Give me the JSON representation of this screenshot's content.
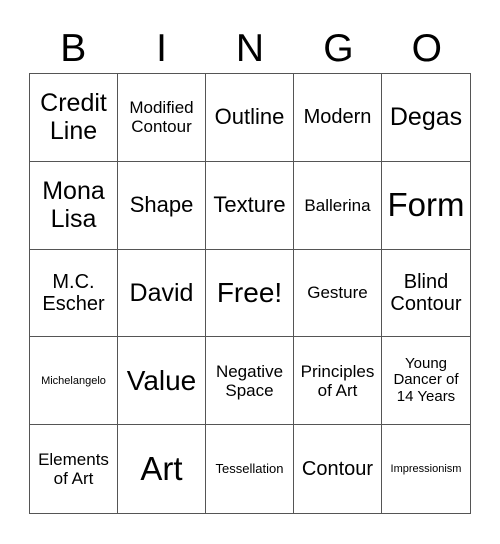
{
  "header": {
    "letters": [
      "B",
      "I",
      "N",
      "G",
      "O"
    ]
  },
  "board": {
    "rows": [
      [
        "Credit Line",
        "Modified Contour",
        "Outline",
        "Modern",
        "Degas"
      ],
      [
        "Mona Lisa",
        "Shape",
        "Texture",
        "Ballerina",
        "Form"
      ],
      [
        "M.C. Escher",
        "David",
        "Free!",
        "Gesture",
        "Blind Contour"
      ],
      [
        "Michelangelo",
        "Value",
        "Negative Space",
        "Principles of Art",
        "Young Dancer of 14 Years"
      ],
      [
        "Elements of Art",
        "Art",
        "Tessellation",
        "Contour",
        "Impressionism"
      ]
    ]
  },
  "colors": {
    "grid_line": "#555555",
    "text": "#000000",
    "background": "#ffffff"
  }
}
